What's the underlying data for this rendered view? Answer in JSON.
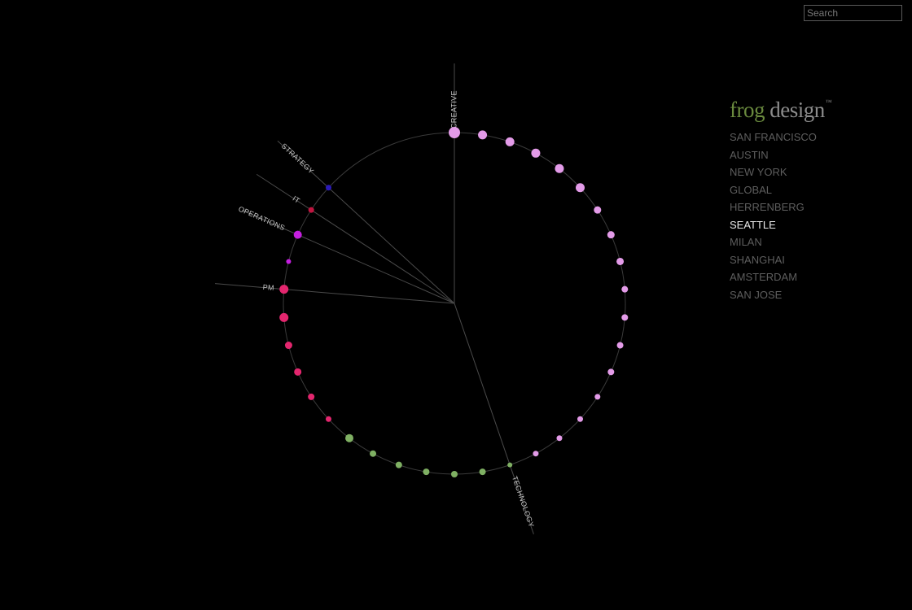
{
  "search": {
    "placeholder": "Search"
  },
  "brand": {
    "part1": "frog",
    "part2": " design",
    "tm": "™"
  },
  "offices": [
    {
      "name": "SAN FRANCISCO",
      "active": false
    },
    {
      "name": "AUSTIN",
      "active": false
    },
    {
      "name": "NEW YORK",
      "active": false
    },
    {
      "name": "GLOBAL",
      "active": false
    },
    {
      "name": "HERRENBERG",
      "active": false
    },
    {
      "name": "SEATTLE",
      "active": true
    },
    {
      "name": "MILAN",
      "active": false
    },
    {
      "name": "SHANGHAI",
      "active": false
    },
    {
      "name": "AMSTERDAM",
      "active": false
    },
    {
      "name": "SAN JOSE",
      "active": false
    }
  ],
  "colors": {
    "creative": "#e39be8",
    "technology": "#7fb063",
    "pm": "#e3266e",
    "operations": "#c51fe0",
    "it": "#c01540",
    "strategy": "#2b1ab8",
    "ring": "#3a3a3a",
    "axis": "#4a4a4a"
  },
  "chart_data": {
    "type": "radial-team",
    "departments": [
      {
        "name": "CREATIVE",
        "color": "creative",
        "members": 17
      },
      {
        "name": "TECHNOLOGY",
        "color": "technology",
        "members": 7
      },
      {
        "name": "PM",
        "color": "pm",
        "members": 6
      },
      {
        "name": "OPERATIONS",
        "color": "operations",
        "members": 2
      },
      {
        "name": "IT",
        "color": "it",
        "members": 1
      },
      {
        "name": "STRATEGY",
        "color": "strategy",
        "members": 1
      }
    ]
  }
}
